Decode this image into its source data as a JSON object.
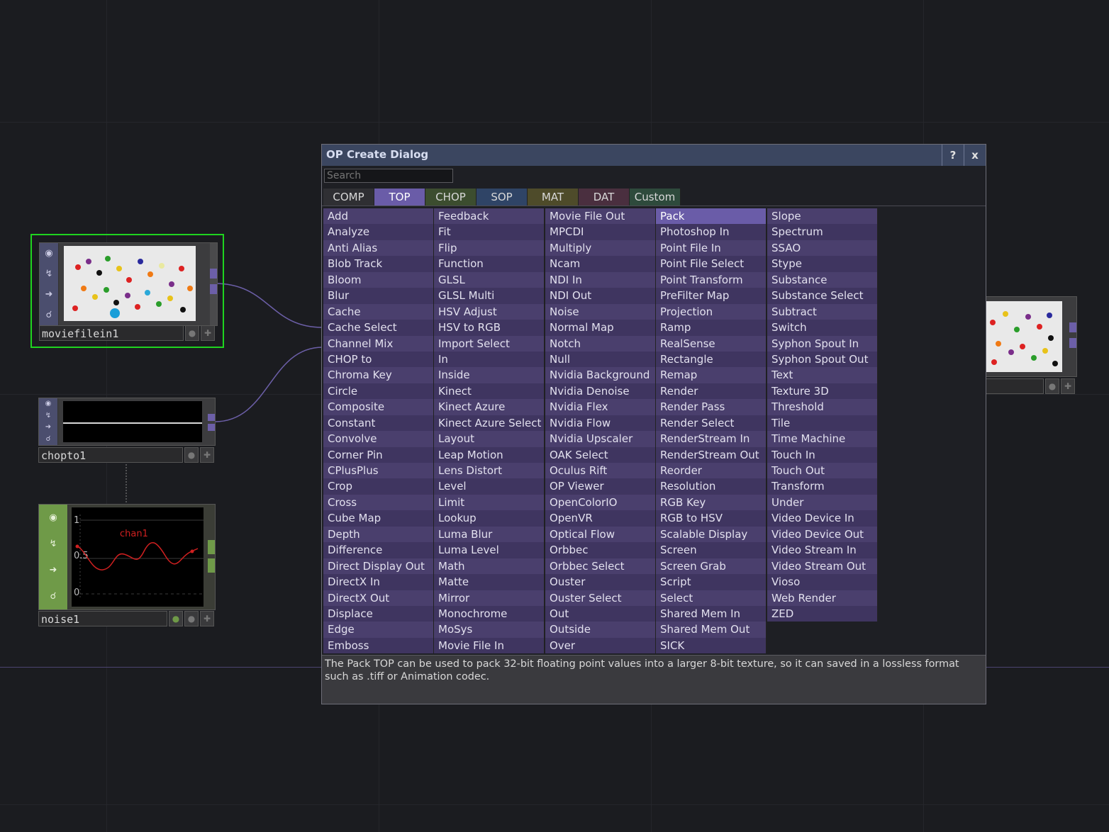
{
  "nodes": {
    "moviefilein": {
      "name": "moviefilein1"
    },
    "chopto": {
      "name": "chopto1"
    },
    "noise": {
      "name": "noise1",
      "chart_title": "chan1",
      "tick_1": "1",
      "tick_05": "0.5",
      "tick_0": "0"
    }
  },
  "dialog": {
    "title": "OP Create Dialog",
    "help_label": "?",
    "close_label": "x",
    "search_placeholder": "Search",
    "tabs": [
      {
        "label": "COMP",
        "color": "#2f2f33"
      },
      {
        "label": "TOP",
        "color": "#6a5ca8"
      },
      {
        "label": "CHOP",
        "color": "#3c4d2f"
      },
      {
        "label": "SOP",
        "color": "#2f4466"
      },
      {
        "label": "MAT",
        "color": "#4e4b2a"
      },
      {
        "label": "DAT",
        "color": "#4a2f3f"
      },
      {
        "label": "Custom",
        "color": "#2e4a3c"
      }
    ],
    "selected_tab": "TOP",
    "selected_item": "Pack",
    "columns": [
      [
        "Add",
        "Analyze",
        "Anti Alias",
        "Blob Track",
        "Bloom",
        "Blur",
        "Cache",
        "Cache Select",
        "Channel Mix",
        "CHOP to",
        "Chroma Key",
        "Circle",
        "Composite",
        "Constant",
        "Convolve",
        "Corner Pin",
        "CPlusPlus",
        "Crop",
        "Cross",
        "Cube Map",
        "Depth",
        "Difference",
        "Direct Display Out",
        "DirectX In",
        "DirectX Out",
        "Displace",
        "Edge",
        "Emboss"
      ],
      [
        "Feedback",
        "Fit",
        "Flip",
        "Function",
        "GLSL",
        "GLSL Multi",
        "HSV Adjust",
        "HSV to RGB",
        "Import Select",
        "In",
        "Inside",
        "Kinect",
        "Kinect Azure",
        "Kinect Azure Select",
        "Layout",
        "Leap Motion",
        "Lens Distort",
        "Level",
        "Limit",
        "Lookup",
        "Luma Blur",
        "Luma Level",
        "Math",
        "Matte",
        "Mirror",
        "Monochrome",
        "MoSys",
        "Movie File In"
      ],
      [
        "Movie File Out",
        "MPCDI",
        "Multiply",
        "Ncam",
        "NDI In",
        "NDI Out",
        "Noise",
        "Normal Map",
        "Notch",
        "Null",
        "Nvidia Background",
        "Nvidia Denoise",
        "Nvidia Flex",
        "Nvidia Flow",
        "Nvidia Upscaler",
        "OAK Select",
        "Oculus Rift",
        "OP Viewer",
        "OpenColorIO",
        "OpenVR",
        "Optical Flow",
        "Orbbec",
        "Orbbec Select",
        "Ouster",
        "Ouster Select",
        "Out",
        "Outside",
        "Over"
      ],
      [
        "Pack",
        "Photoshop In",
        "Point File In",
        "Point File Select",
        "Point Transform",
        "PreFilter Map",
        "Projection",
        "Ramp",
        "RealSense",
        "Rectangle",
        "Remap",
        "Render",
        "Render Pass",
        "Render Select",
        "RenderStream In",
        "RenderStream Out",
        "Reorder",
        "Resolution",
        "RGB Key",
        "RGB to HSV",
        "Scalable Display",
        "Screen",
        "Screen Grab",
        "Script",
        "Select",
        "Shared Mem In",
        "Shared Mem Out",
        "SICK"
      ],
      [
        "Slope",
        "Spectrum",
        "SSAO",
        "Stype",
        "Substance",
        "Substance Select",
        "Subtract",
        "Switch",
        "Syphon Spout In",
        "Syphon Spout Out",
        "Text",
        "Texture 3D",
        "Threshold",
        "Tile",
        "Time Machine",
        "Touch In",
        "Touch Out",
        "Transform",
        "Under",
        "Video Device In",
        "Video Device Out",
        "Video Stream In",
        "Video Stream Out",
        "Vioso",
        "Web Render",
        "ZED"
      ]
    ],
    "description": "The Pack TOP can be used to pack 32-bit floating point values into a larger 8-bit texture, so it can saved in a lossless format such as .tiff or Animation codec."
  }
}
